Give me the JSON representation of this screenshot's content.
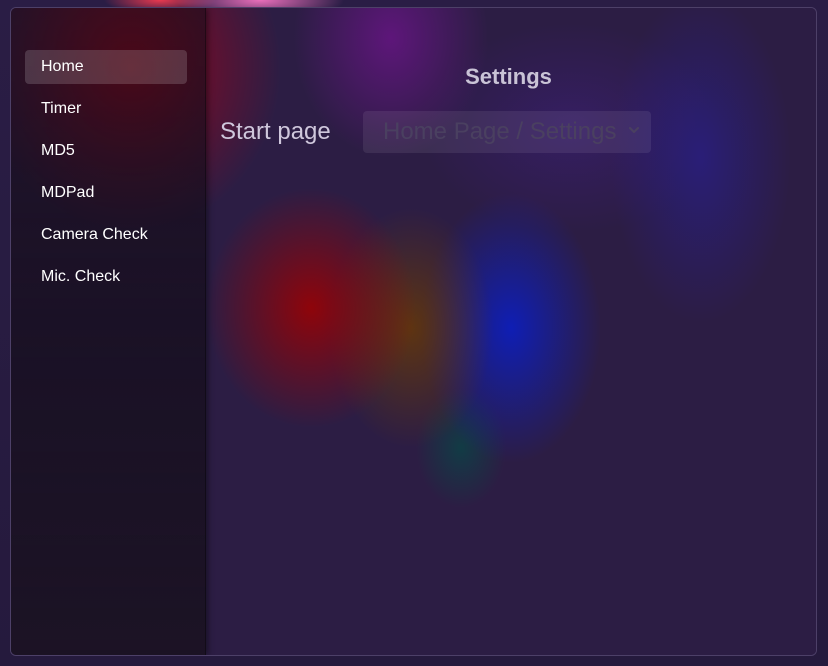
{
  "sidebar": {
    "items": [
      {
        "label": "Home",
        "active": true
      },
      {
        "label": "Timer",
        "active": false
      },
      {
        "label": "MD5",
        "active": false
      },
      {
        "label": "MDPad",
        "active": false
      },
      {
        "label": "Camera Check",
        "active": false
      },
      {
        "label": "Mic. Check",
        "active": false
      }
    ]
  },
  "main": {
    "title": "Settings",
    "start_page": {
      "label": "Start page",
      "selected": "Home Page / Settings",
      "icon": "chevron-down-icon"
    }
  },
  "colors": {
    "text_primary": "#ffffff",
    "text_muted": "#c9c3d6",
    "select_text": "#4a4060",
    "active_item_bg": "rgba(255,255,255,0.16)"
  }
}
